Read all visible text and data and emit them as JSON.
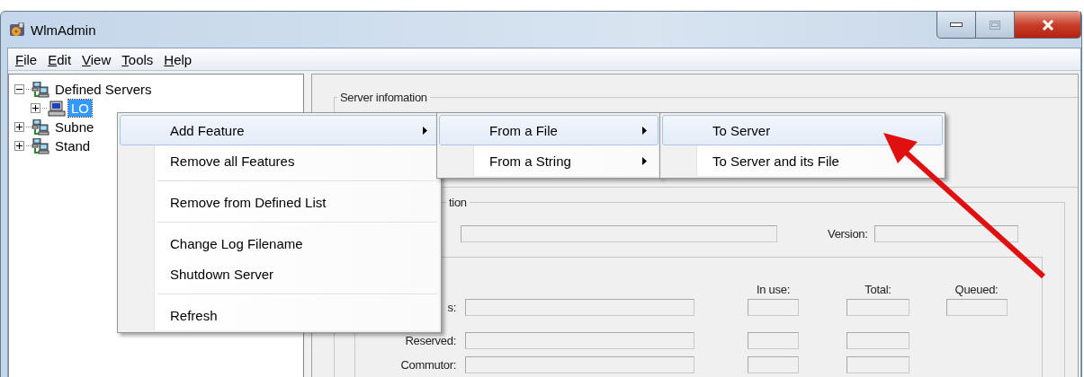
{
  "window": {
    "title": "WlmAdmin"
  },
  "menu_bar": [
    {
      "label": "File"
    },
    {
      "label": "Edit"
    },
    {
      "label": "View"
    },
    {
      "label": "Tools"
    },
    {
      "label": "Help"
    }
  ],
  "tree": [
    {
      "label": "Defined Servers",
      "kind": "group",
      "expanded": true,
      "selected": false,
      "children": [
        {
          "label": "LO",
          "kind": "server",
          "expanded": false,
          "selected": true
        }
      ]
    },
    {
      "label": "Subne",
      "kind": "group",
      "expanded": false,
      "selected": false
    },
    {
      "label": "Stand",
      "kind": "group",
      "expanded": false,
      "selected": false
    }
  ],
  "server_information": {
    "title": "Server infomation"
  },
  "feature_section": {
    "title": "tion",
    "version_label": "Version:"
  },
  "usage": {
    "columns": [
      "In use:",
      "Total:",
      "Queued:"
    ],
    "rows": [
      {
        "label": "s:",
        "queued_field": true
      },
      {
        "label": "Reserved:",
        "queued_field": false
      },
      {
        "label": "Commutor:",
        "queued_field": false
      }
    ]
  },
  "context_menu": {
    "items": [
      {
        "kind": "item",
        "label": "Add Feature",
        "submenu": true,
        "selected": true
      },
      {
        "kind": "item",
        "label": "Remove all Features",
        "submenu": false,
        "selected": false
      },
      {
        "kind": "separator"
      },
      {
        "kind": "item",
        "label": "Remove from Defined List",
        "submenu": false,
        "selected": false
      },
      {
        "kind": "separator"
      },
      {
        "kind": "item",
        "label": "Change Log Filename",
        "submenu": false,
        "selected": false
      },
      {
        "kind": "item",
        "label": "Shutdown Server",
        "submenu": false,
        "selected": false
      },
      {
        "kind": "separator"
      },
      {
        "kind": "item",
        "label": "Refresh",
        "submenu": false,
        "selected": false
      }
    ]
  },
  "submenu": {
    "items": [
      {
        "kind": "item",
        "label": "From a File",
        "submenu": true,
        "selected": true
      },
      {
        "kind": "item",
        "label": "From a String",
        "submenu": true,
        "selected": false
      }
    ]
  },
  "submenu_2": {
    "items": [
      {
        "kind": "item",
        "label": "To Server",
        "submenu": false,
        "selected": true
      },
      {
        "kind": "item",
        "label": "To Server and its File",
        "submenu": false,
        "selected": false
      }
    ]
  }
}
